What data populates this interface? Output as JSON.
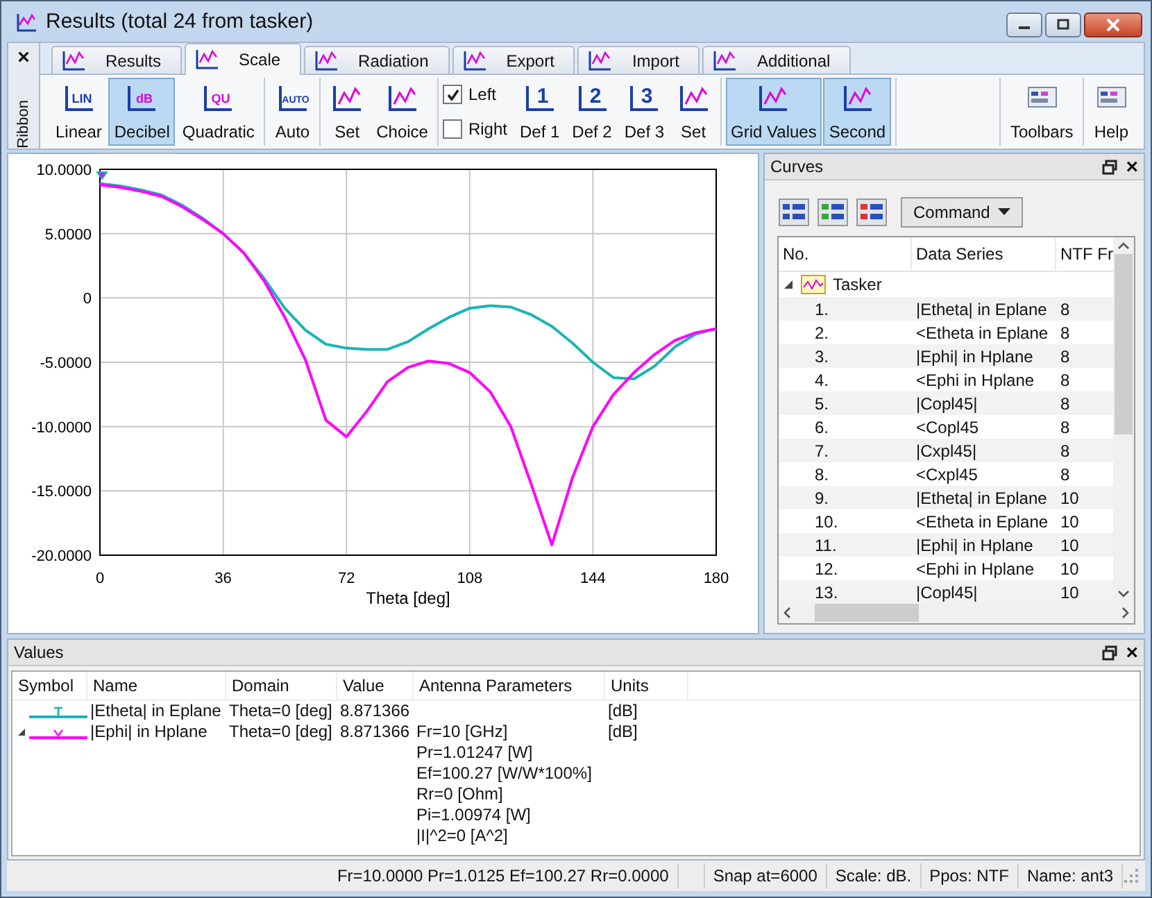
{
  "window": {
    "title": "Results (total 24 from tasker)"
  },
  "ribbon": {
    "label": "Ribbon",
    "close_glyph": "×",
    "tabs": [
      {
        "label": "Results",
        "selected": false
      },
      {
        "label": "Scale",
        "selected": true
      },
      {
        "label": "Radiation",
        "selected": false
      },
      {
        "label": "Export",
        "selected": false
      },
      {
        "label": "Import",
        "selected": false
      },
      {
        "label": "Additional",
        "selected": false
      }
    ],
    "groups": [
      [
        {
          "kind": "button",
          "label": "Linear",
          "glyph": "LIN",
          "selected": false
        },
        {
          "kind": "button",
          "label": "Decibel",
          "glyph": "dB",
          "selected": true
        },
        {
          "kind": "button",
          "label": "Quadratic",
          "glyph": "QU",
          "selected": false
        }
      ],
      [
        {
          "kind": "button",
          "label": "Auto",
          "glyph": "AUTO",
          "selected": false
        }
      ],
      [
        {
          "kind": "button",
          "label": "Set",
          "selected": false
        },
        {
          "kind": "button",
          "label": "Choice",
          "selected": false
        }
      ],
      [
        {
          "kind": "checkbox",
          "label": "Left",
          "checked": true
        },
        {
          "kind": "checkbox",
          "label": "Right",
          "checked": false
        },
        {
          "kind": "button",
          "label": "Def 1",
          "glyph": "1",
          "selected": false
        },
        {
          "kind": "button",
          "label": "Def 2",
          "glyph": "2",
          "selected": false
        },
        {
          "kind": "button",
          "label": "Def 3",
          "glyph": "3",
          "selected": false
        },
        {
          "kind": "button",
          "label": "Set",
          "selected": false
        }
      ],
      [
        {
          "kind": "button",
          "label": "Grid Values",
          "selected": true
        },
        {
          "kind": "button",
          "label": "Second",
          "selected": true
        }
      ]
    ],
    "right_groups": [
      [
        {
          "kind": "button",
          "label": "Toolbars",
          "selected": false
        }
      ],
      [
        {
          "kind": "button",
          "label": "Help",
          "selected": false
        }
      ]
    ]
  },
  "chart": {
    "chart_data": {
      "type": "line",
      "xlabel": "Theta [deg]",
      "grid": true,
      "x": [
        0,
        6,
        12,
        18,
        24,
        30,
        36,
        42,
        48,
        54,
        60,
        66,
        72,
        78,
        84,
        90,
        96,
        102,
        108,
        114,
        120,
        126,
        132,
        138,
        144,
        150,
        156,
        162,
        168,
        174,
        180
      ],
      "series": [
        {
          "color": "#1ab5b5",
          "values": [
            8.9,
            8.7,
            8.4,
            8.0,
            7.2,
            6.2,
            5.0,
            3.5,
            1.5,
            -0.8,
            -2.5,
            -3.6,
            -3.9,
            -4.0,
            -4.0,
            -3.4,
            -2.4,
            -1.5,
            -0.8,
            -0.6,
            -0.7,
            -1.3,
            -2.2,
            -3.5,
            -5.0,
            -6.2,
            -6.3,
            -5.3,
            -3.8,
            -2.8,
            -2.4
          ]
        },
        {
          "color": "#ff00ff",
          "values": [
            8.8,
            8.6,
            8.3,
            7.9,
            7.1,
            6.1,
            5.0,
            3.5,
            1.3,
            -1.5,
            -4.8,
            -9.5,
            -10.8,
            -8.8,
            -6.5,
            -5.4,
            -4.9,
            -5.1,
            -5.8,
            -7.3,
            -10.0,
            -14.5,
            -19.2,
            -14.0,
            -10.0,
            -7.5,
            -5.8,
            -4.4,
            -3.3,
            -2.7,
            -2.4
          ]
        }
      ],
      "xlim": [
        0,
        180
      ],
      "ylim": [
        -20,
        10
      ],
      "xticks": [
        0,
        36,
        72,
        108,
        144,
        180
      ],
      "yticks": [
        {
          "value": 10,
          "label": "10.0000"
        },
        {
          "value": 5,
          "label": "5.0000"
        },
        {
          "value": 0,
          "label": "0"
        },
        {
          "value": -5,
          "label": "-5.0000"
        },
        {
          "value": -10,
          "label": "-10.0000"
        },
        {
          "value": -15,
          "label": "-15.0000"
        },
        {
          "value": -20,
          "label": "-20.0000"
        }
      ]
    }
  },
  "curves": {
    "title": "Curves",
    "close_glyph": "×",
    "command": "Command",
    "columns": [
      "No.",
      "Data Series",
      "NTF Fr"
    ],
    "root": {
      "label": "Tasker",
      "expanded": true,
      "children": [
        {
          "no": "1.",
          "series": "|Etheta| in Eplane",
          "ntf": "8"
        },
        {
          "no": "2.",
          "series": "<Etheta in Eplane",
          "ntf": "8"
        },
        {
          "no": "3.",
          "series": "|Ephi| in Hplane",
          "ntf": "8"
        },
        {
          "no": "4.",
          "series": "<Ephi in Hplane",
          "ntf": "8"
        },
        {
          "no": "5.",
          "series": "|Copl45|",
          "ntf": "8"
        },
        {
          "no": "6.",
          "series": "<Copl45",
          "ntf": "8"
        },
        {
          "no": "7.",
          "series": "|Cxpl45|",
          "ntf": "8"
        },
        {
          "no": "8.",
          "series": "<Cxpl45",
          "ntf": "8"
        },
        {
          "no": "9.",
          "series": "|Etheta| in Eplane",
          "ntf": "10"
        },
        {
          "no": "10.",
          "series": "<Etheta in Eplane",
          "ntf": "10"
        },
        {
          "no": "11.",
          "series": "|Ephi| in Hplane",
          "ntf": "10"
        },
        {
          "no": "12.",
          "series": "<Ephi in Hplane",
          "ntf": "10"
        },
        {
          "no": "13.",
          "series": "|Copl45|",
          "ntf": "10"
        }
      ]
    }
  },
  "values": {
    "title": "Values",
    "close_glyph": "×",
    "columns": [
      "Symbol",
      "Name",
      "Domain",
      "Value",
      "Antenna Parameters",
      "Units"
    ],
    "rows": [
      {
        "color": "#1ab5b5",
        "kind": "tee",
        "expandable": false,
        "name": "|Etheta| in Eplane",
        "domain": "Theta=0 [deg]",
        "value": "8.871366",
        "parameters": [],
        "units": "[dB]"
      },
      {
        "color": "#ff00ff",
        "kind": "vee",
        "expandable": true,
        "name": "|Ephi| in Hplane",
        "domain": "Theta=0 [deg]",
        "value": "8.871366",
        "parameters": [
          "Fr=10 [GHz]",
          "Pr=1.01247 [W]",
          "Ef=100.27 [W/W*100%]",
          "Rr=0 [Ohm]",
          "Pi=1.00974 [W]",
          "|I|^2=0 [A^2]"
        ],
        "units": "[dB]"
      }
    ]
  },
  "status_bar": [
    "Fr=10.0000 Pr=1.0125 Ef=100.27 Rr=0.0000",
    "Snap at=6000",
    "Scale: dB.",
    "Ppos: NTF",
    "Name: ant3"
  ]
}
